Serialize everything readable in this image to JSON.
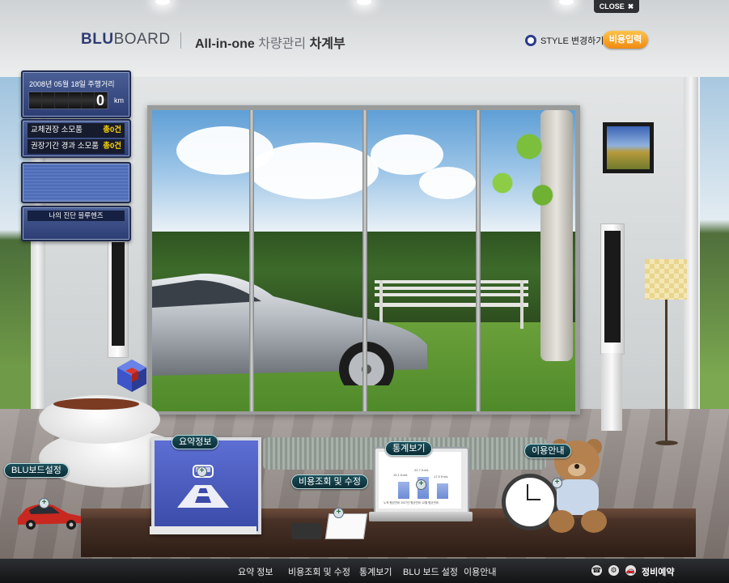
{
  "header": {
    "logo_blu": "BLU",
    "logo_board": "BOARD",
    "tagline_a": "All-in-one",
    "tagline_b": "차량관리",
    "tagline_c": "차계부",
    "style_label": "STYLE 변경하기",
    "cost_input_label": "비용입력",
    "close_label": "CLOSE",
    "close_icon": "✖"
  },
  "odometer": {
    "date_label": "2008년 05월 18일 주행거리",
    "value": "0",
    "unit": "km"
  },
  "parts": [
    {
      "label": "교체권장 소모품",
      "count": "총0건"
    },
    {
      "label": "권장기간 경과 소모품",
      "count": "총0건"
    }
  ],
  "diagnosis_label": "나의 진단 블루헨즈",
  "hotspots": {
    "blu_settings": "BLU보드설정",
    "summary": "요약정보",
    "cost_query": "비용조회 및 수정",
    "stats": "통계보기",
    "guide": "이용안내"
  },
  "laptop_chart": {
    "bar_labels": [
      "19.1 Km/L",
      "22.7 Km/L",
      "17.9 Km/L"
    ],
    "values": [
      19.1,
      22.7,
      17.9
    ],
    "caption": "누적 평균연비 2007년 평균연비 12월 평균연비"
  },
  "bottom_nav": {
    "items": [
      "요약 정보",
      "비용조회 및 수정",
      "통계보기",
      "BLU 보드 설정",
      "이용안내"
    ],
    "reserve_label": "정비예약"
  },
  "colors": {
    "brand_navy": "#2f3a73",
    "accent_orange": "#f08a12",
    "warning_yellow": "#ffd400"
  }
}
